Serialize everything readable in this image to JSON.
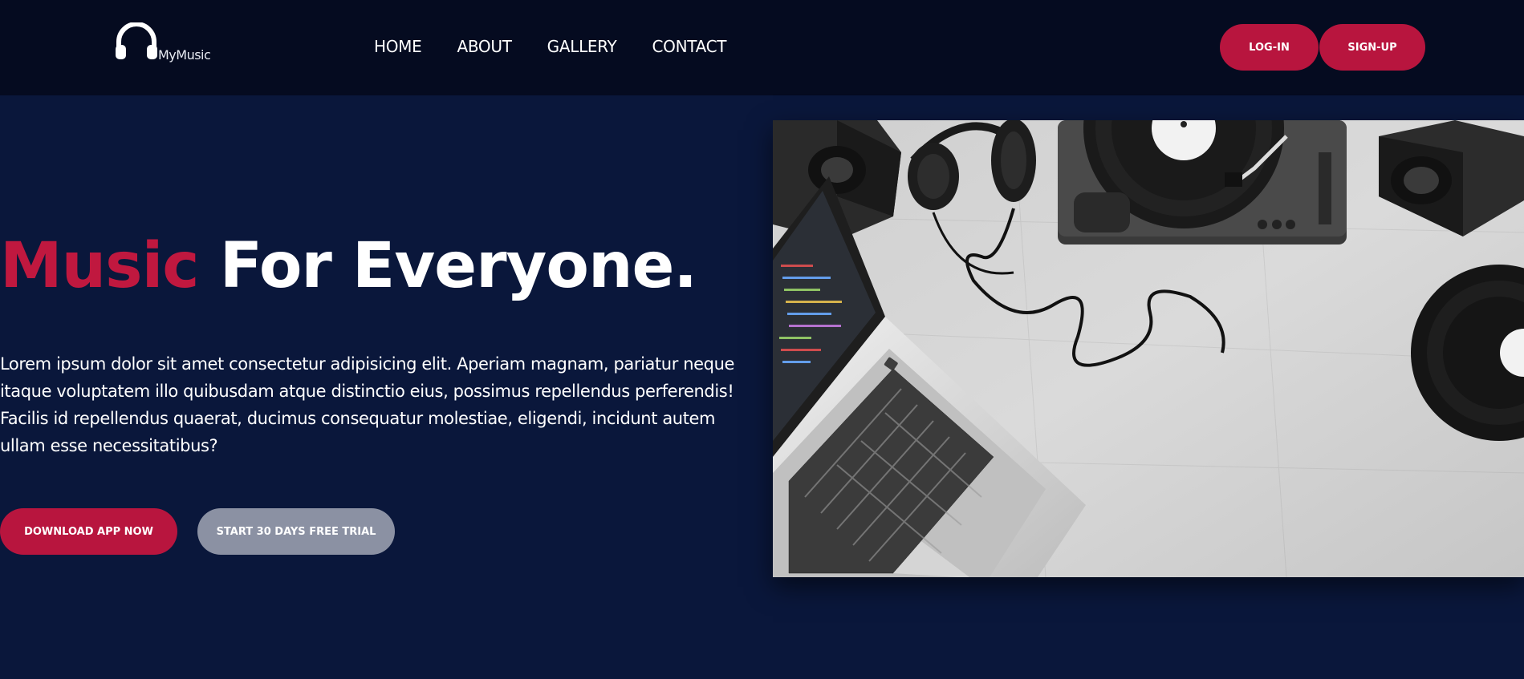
{
  "header": {
    "logo_text": "MyMusic",
    "nav": [
      {
        "label": "HOME"
      },
      {
        "label": "ABOUT"
      },
      {
        "label": "GALLERY"
      },
      {
        "label": "CONTACT"
      }
    ],
    "login_label": "LOG-IN",
    "signup_label": "SIGN-UP"
  },
  "hero": {
    "title_accent": "Music",
    "title_rest": " For Everyone.",
    "description": "Lorem ipsum dolor sit amet consectetur adipisicing elit. Aperiam magnam, pariatur neque itaque voluptatem illo quibusdam atque distinctio eius, possimus repellendus perferendis! Facilis id repellendus quaerat, ducimus consequatur molestiae, eligendi, incidunt autem ullam esse necessitatibus?",
    "download_label": "DOWNLOAD APP NOW",
    "trial_label": "START 30 DAYS FREE TRIAL"
  },
  "colors": {
    "page_bg": "#0a173b",
    "header_bg": "#050b20",
    "accent": "#b8153e",
    "muted_button": "#8b91a3"
  },
  "icons": {
    "logo": "headphones-icon"
  }
}
